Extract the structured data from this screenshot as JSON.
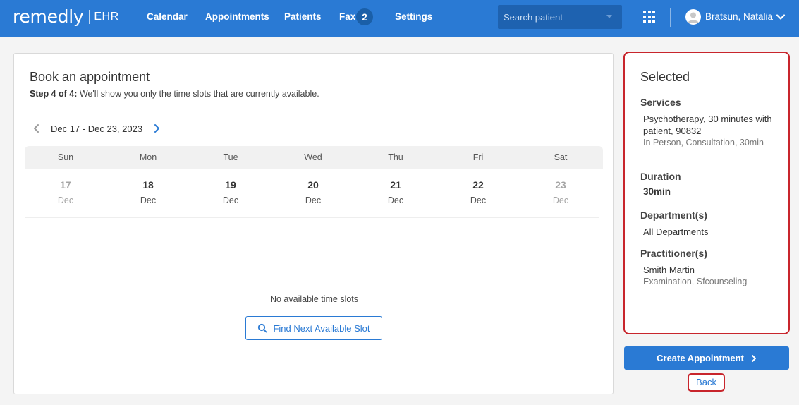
{
  "brand": {
    "name": "remedly",
    "product": "EHR"
  },
  "nav": {
    "items": [
      {
        "label": "Calendar"
      },
      {
        "label": "Appointments"
      },
      {
        "label": "Patients"
      },
      {
        "label": "Fax",
        "badge": "2"
      },
      {
        "label": "Settings"
      }
    ],
    "search_placeholder": "Search patient",
    "user_name": "Bratsun, Natalia",
    "icons": [
      "apps-grid-icon",
      "user-avatar-icon",
      "chevron-down-icon"
    ]
  },
  "booking": {
    "title": "Book an appointment",
    "step_label": "Step 4 of 4:",
    "step_text": " We'll show you only the time slots that are currently available.",
    "week_range": "Dec 17 - Dec 23, 2023",
    "days": [
      {
        "name": "Sun",
        "num": "17",
        "month": "Dec",
        "available": false
      },
      {
        "name": "Mon",
        "num": "18",
        "month": "Dec",
        "available": true
      },
      {
        "name": "Tue",
        "num": "19",
        "month": "Dec",
        "available": true
      },
      {
        "name": "Wed",
        "num": "20",
        "month": "Dec",
        "available": true
      },
      {
        "name": "Thu",
        "num": "21",
        "month": "Dec",
        "available": true
      },
      {
        "name": "Fri",
        "num": "22",
        "month": "Dec",
        "available": true
      },
      {
        "name": "Sat",
        "num": "23",
        "month": "Dec",
        "available": false
      }
    ],
    "empty_message": "No available time slots",
    "find_button": "Find Next Available Slot"
  },
  "selected": {
    "title": "Selected",
    "services_label": "Services",
    "service_name": "Psychotherapy, 30 minutes with patient, 90832",
    "service_detail": "In Person, Consultation, 30min",
    "duration_label": "Duration",
    "duration_value": "30min",
    "department_label": "Department(s)",
    "department_value": "All Departments",
    "practitioner_label": "Practitioner(s)",
    "practitioner_name": "Smith Martin",
    "practitioner_detail": "Examination, Sfcounseling"
  },
  "actions": {
    "create_label": "Create Appointment",
    "back_label": "Back"
  },
  "colors": {
    "primary": "#2a7ad4",
    "highlight_border": "#c8252c",
    "badge": "#1a5fa8"
  }
}
